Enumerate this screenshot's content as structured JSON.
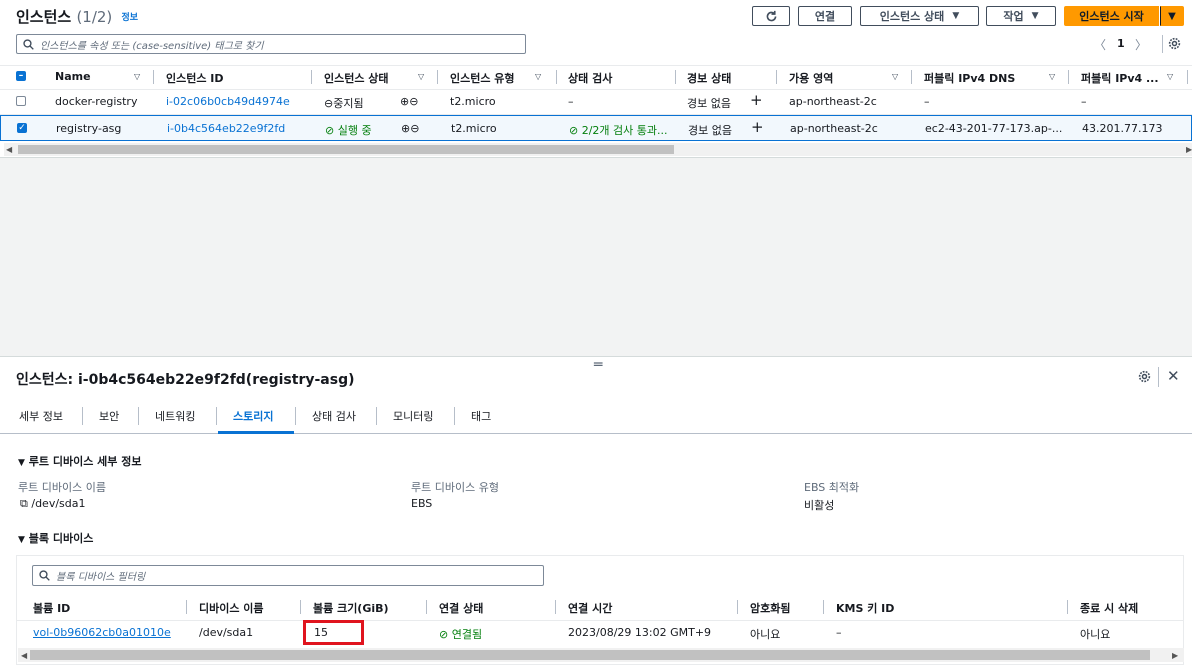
{
  "header": {
    "title": "인스턴스",
    "count": "(1/2)",
    "info": "정보",
    "buttons": {
      "connect": "연결",
      "instance_state": "인스턴스 상태",
      "actions": "작업",
      "launch": "인스턴스 시작"
    },
    "search_placeholder": "인스턴스를 속성 또는 (case-sensitive) 태그로 찾기",
    "page": "1"
  },
  "table": {
    "columns": [
      "Name",
      "인스턴스 ID",
      "인스턴스 상태",
      "인스턴스 유형",
      "상태 검사",
      "경보 상태",
      "가용 영역",
      "퍼블릭 IPv4 DNS",
      "퍼블릭 IPv4 ..."
    ],
    "rows": [
      {
        "name": "docker-registry",
        "id": "i-02c06b0cb49d4974e",
        "state": "중지됨",
        "type": "t2.micro",
        "check": "–",
        "alarm": "경보 없음",
        "az": "ap-northeast-2c",
        "dns": "–",
        "ip": "–",
        "selected": false
      },
      {
        "name": "registry-asg",
        "id": "i-0b4c564eb22e9f2fd",
        "state": "실행 중",
        "type": "t2.micro",
        "check": "2/2개 검사 통과...",
        "alarm": "경보 없음",
        "az": "ap-northeast-2c",
        "dns": "ec2-43-201-77-173.ap-...",
        "ip": "43.201.77.173",
        "selected": true
      }
    ]
  },
  "detail": {
    "title": "인스턴스: i-0b4c564eb22e9f2fd(registry-asg)",
    "tabs": [
      "세부 정보",
      "보안",
      "네트워킹",
      "스토리지",
      "상태 검사",
      "모니터링",
      "태그"
    ],
    "active_tab": "스토리지",
    "root_section": "루트 디바이스 세부 정보",
    "root_device_name_label": "루트 디바이스 이름",
    "root_device_name": "/dev/sda1",
    "root_device_type_label": "루트 디바이스 유형",
    "root_device_type": "EBS",
    "ebs_optimized_label": "EBS 최적화",
    "ebs_optimized": "비활성",
    "block_section": "블록 디바이스",
    "block_filter_placeholder": "블록 디바이스 필터링",
    "block_columns": [
      "볼륨 ID",
      "디바이스 이름",
      "볼륨 크기(GiB)",
      "연결 상태",
      "연결 시간",
      "암호화됨",
      "KMS 키 ID",
      "종료 시 삭제"
    ],
    "block_row": {
      "volume_id": "vol-0b96062cb0a01010e",
      "device": "/dev/sda1",
      "size": "15",
      "attach_state": "연결됨",
      "attach_time": "2023/08/29 13:02 GMT+9",
      "encrypted": "아니요",
      "kms": "–",
      "delete_on_term": "아니요"
    }
  },
  "colors": {
    "accent": "#0972d3",
    "launch": "#ff9900",
    "success": "#037f0c",
    "highlight": "#e0141e"
  }
}
